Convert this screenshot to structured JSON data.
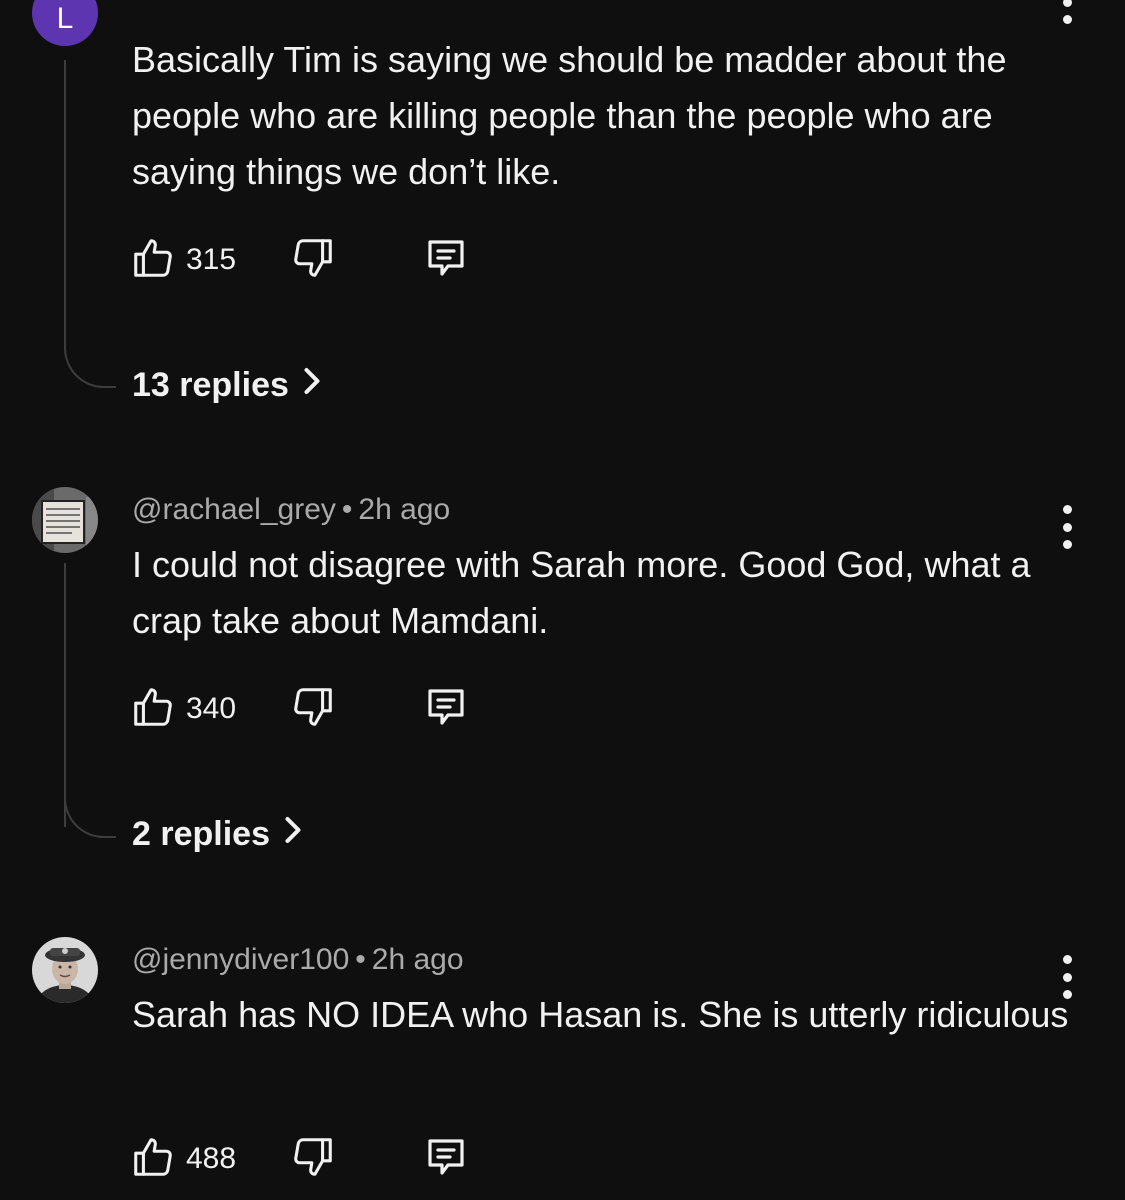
{
  "comments": [
    {
      "avatar_letter": "L",
      "text": "Basically Tim is saying we should be madder about the people who are killing people than the people who are saying things we don’t like.",
      "likes": "315",
      "replies_label": "13 replies"
    },
    {
      "handle": "@rachael_grey",
      "separator": "•",
      "time": "2h ago",
      "text": "I could not disagree with Sarah more. Good God, what a crap take about Mamdani.",
      "likes": "340",
      "replies_label": "2 replies"
    },
    {
      "handle": "@jennydiver100",
      "separator": "•",
      "time": "2h ago",
      "text": "Sarah has NO IDEA who Hasan is. She is utterly ridiculous",
      "likes": "488"
    }
  ],
  "icons": {
    "like": "thumbs-up-icon",
    "dislike": "thumbs-down-icon",
    "reply": "reply-comment-icon",
    "more": "more-vertical-icon",
    "replies_chevron": "chevron-right-icon"
  },
  "colors": {
    "background": "#0f0f0f",
    "text_primary": "#f1f1f1",
    "text_secondary": "#aaaaaa",
    "thread_line": "#3d3d3d",
    "avatar_purple": "#5e35b1"
  }
}
